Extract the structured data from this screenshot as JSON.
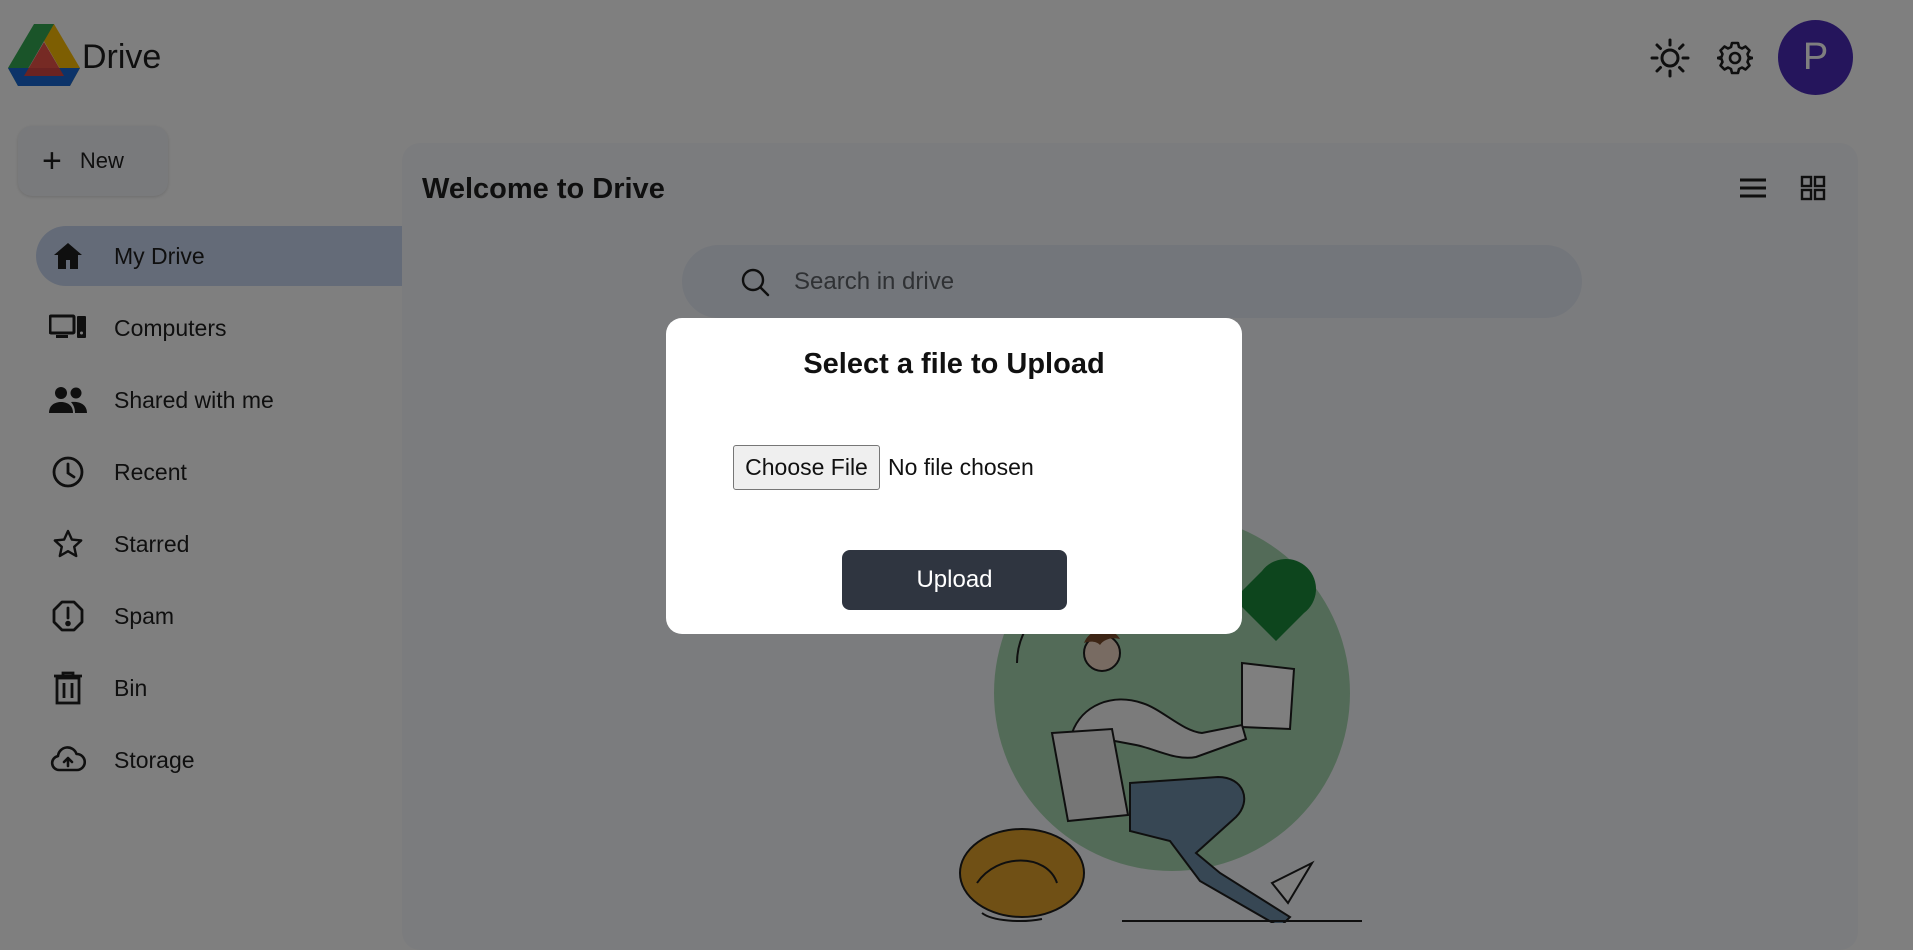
{
  "header": {
    "brand": "Drive",
    "avatar_initial": "P",
    "icons": [
      "drive-logo",
      "sun-icon",
      "gear-icon"
    ]
  },
  "sidebar": {
    "new_label": "New",
    "items": [
      {
        "label": "My Drive",
        "icon": "home-icon",
        "active": true
      },
      {
        "label": "Computers",
        "icon": "computer-icon",
        "active": false
      },
      {
        "label": "Shared with me",
        "icon": "people-icon",
        "active": false
      },
      {
        "label": "Recent",
        "icon": "clock-icon",
        "active": false
      },
      {
        "label": "Starred",
        "icon": "star-icon",
        "active": false
      },
      {
        "label": "Spam",
        "icon": "alert-icon",
        "active": false
      },
      {
        "label": "Bin",
        "icon": "trash-icon",
        "active": false
      },
      {
        "label": "Storage",
        "icon": "cloud-icon",
        "active": false
      }
    ]
  },
  "main": {
    "title": "Welcome to Drive",
    "search_placeholder": "Search in drive"
  },
  "modal": {
    "title": "Select a file to Upload",
    "choose_label": "Choose File",
    "file_status": "No file chosen",
    "upload_label": "Upload"
  },
  "colors": {
    "avatar": "#4a2bb8",
    "active_nav": "#c9d7f0",
    "upload_button": "#2f3540",
    "overlay": "rgba(0,0,0,0.5)"
  }
}
